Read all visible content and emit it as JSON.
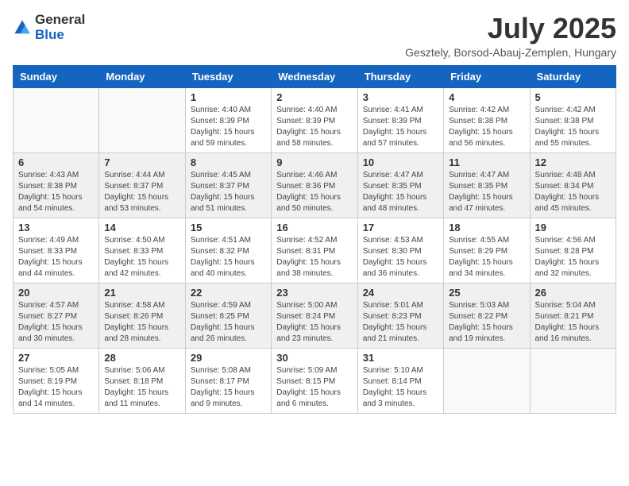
{
  "header": {
    "logo_general": "General",
    "logo_blue": "Blue",
    "month_year": "July 2025",
    "location": "Gesztely, Borsod-Abauj-Zemplen, Hungary"
  },
  "weekdays": [
    "Sunday",
    "Monday",
    "Tuesday",
    "Wednesday",
    "Thursday",
    "Friday",
    "Saturday"
  ],
  "weeks": [
    [
      {
        "day": "",
        "sunrise": "",
        "sunset": "",
        "daylight": ""
      },
      {
        "day": "",
        "sunrise": "",
        "sunset": "",
        "daylight": ""
      },
      {
        "day": "1",
        "sunrise": "Sunrise: 4:40 AM",
        "sunset": "Sunset: 8:39 PM",
        "daylight": "Daylight: 15 hours and 59 minutes."
      },
      {
        "day": "2",
        "sunrise": "Sunrise: 4:40 AM",
        "sunset": "Sunset: 8:39 PM",
        "daylight": "Daylight: 15 hours and 58 minutes."
      },
      {
        "day": "3",
        "sunrise": "Sunrise: 4:41 AM",
        "sunset": "Sunset: 8:39 PM",
        "daylight": "Daylight: 15 hours and 57 minutes."
      },
      {
        "day": "4",
        "sunrise": "Sunrise: 4:42 AM",
        "sunset": "Sunset: 8:38 PM",
        "daylight": "Daylight: 15 hours and 56 minutes."
      },
      {
        "day": "5",
        "sunrise": "Sunrise: 4:42 AM",
        "sunset": "Sunset: 8:38 PM",
        "daylight": "Daylight: 15 hours and 55 minutes."
      }
    ],
    [
      {
        "day": "6",
        "sunrise": "Sunrise: 4:43 AM",
        "sunset": "Sunset: 8:38 PM",
        "daylight": "Daylight: 15 hours and 54 minutes."
      },
      {
        "day": "7",
        "sunrise": "Sunrise: 4:44 AM",
        "sunset": "Sunset: 8:37 PM",
        "daylight": "Daylight: 15 hours and 53 minutes."
      },
      {
        "day": "8",
        "sunrise": "Sunrise: 4:45 AM",
        "sunset": "Sunset: 8:37 PM",
        "daylight": "Daylight: 15 hours and 51 minutes."
      },
      {
        "day": "9",
        "sunrise": "Sunrise: 4:46 AM",
        "sunset": "Sunset: 8:36 PM",
        "daylight": "Daylight: 15 hours and 50 minutes."
      },
      {
        "day": "10",
        "sunrise": "Sunrise: 4:47 AM",
        "sunset": "Sunset: 8:35 PM",
        "daylight": "Daylight: 15 hours and 48 minutes."
      },
      {
        "day": "11",
        "sunrise": "Sunrise: 4:47 AM",
        "sunset": "Sunset: 8:35 PM",
        "daylight": "Daylight: 15 hours and 47 minutes."
      },
      {
        "day": "12",
        "sunrise": "Sunrise: 4:48 AM",
        "sunset": "Sunset: 8:34 PM",
        "daylight": "Daylight: 15 hours and 45 minutes."
      }
    ],
    [
      {
        "day": "13",
        "sunrise": "Sunrise: 4:49 AM",
        "sunset": "Sunset: 8:33 PM",
        "daylight": "Daylight: 15 hours and 44 minutes."
      },
      {
        "day": "14",
        "sunrise": "Sunrise: 4:50 AM",
        "sunset": "Sunset: 8:33 PM",
        "daylight": "Daylight: 15 hours and 42 minutes."
      },
      {
        "day": "15",
        "sunrise": "Sunrise: 4:51 AM",
        "sunset": "Sunset: 8:32 PM",
        "daylight": "Daylight: 15 hours and 40 minutes."
      },
      {
        "day": "16",
        "sunrise": "Sunrise: 4:52 AM",
        "sunset": "Sunset: 8:31 PM",
        "daylight": "Daylight: 15 hours and 38 minutes."
      },
      {
        "day": "17",
        "sunrise": "Sunrise: 4:53 AM",
        "sunset": "Sunset: 8:30 PM",
        "daylight": "Daylight: 15 hours and 36 minutes."
      },
      {
        "day": "18",
        "sunrise": "Sunrise: 4:55 AM",
        "sunset": "Sunset: 8:29 PM",
        "daylight": "Daylight: 15 hours and 34 minutes."
      },
      {
        "day": "19",
        "sunrise": "Sunrise: 4:56 AM",
        "sunset": "Sunset: 8:28 PM",
        "daylight": "Daylight: 15 hours and 32 minutes."
      }
    ],
    [
      {
        "day": "20",
        "sunrise": "Sunrise: 4:57 AM",
        "sunset": "Sunset: 8:27 PM",
        "daylight": "Daylight: 15 hours and 30 minutes."
      },
      {
        "day": "21",
        "sunrise": "Sunrise: 4:58 AM",
        "sunset": "Sunset: 8:26 PM",
        "daylight": "Daylight: 15 hours and 28 minutes."
      },
      {
        "day": "22",
        "sunrise": "Sunrise: 4:59 AM",
        "sunset": "Sunset: 8:25 PM",
        "daylight": "Daylight: 15 hours and 26 minutes."
      },
      {
        "day": "23",
        "sunrise": "Sunrise: 5:00 AM",
        "sunset": "Sunset: 8:24 PM",
        "daylight": "Daylight: 15 hours and 23 minutes."
      },
      {
        "day": "24",
        "sunrise": "Sunrise: 5:01 AM",
        "sunset": "Sunset: 8:23 PM",
        "daylight": "Daylight: 15 hours and 21 minutes."
      },
      {
        "day": "25",
        "sunrise": "Sunrise: 5:03 AM",
        "sunset": "Sunset: 8:22 PM",
        "daylight": "Daylight: 15 hours and 19 minutes."
      },
      {
        "day": "26",
        "sunrise": "Sunrise: 5:04 AM",
        "sunset": "Sunset: 8:21 PM",
        "daylight": "Daylight: 15 hours and 16 minutes."
      }
    ],
    [
      {
        "day": "27",
        "sunrise": "Sunrise: 5:05 AM",
        "sunset": "Sunset: 8:19 PM",
        "daylight": "Daylight: 15 hours and 14 minutes."
      },
      {
        "day": "28",
        "sunrise": "Sunrise: 5:06 AM",
        "sunset": "Sunset: 8:18 PM",
        "daylight": "Daylight: 15 hours and 11 minutes."
      },
      {
        "day": "29",
        "sunrise": "Sunrise: 5:08 AM",
        "sunset": "Sunset: 8:17 PM",
        "daylight": "Daylight: 15 hours and 9 minutes."
      },
      {
        "day": "30",
        "sunrise": "Sunrise: 5:09 AM",
        "sunset": "Sunset: 8:15 PM",
        "daylight": "Daylight: 15 hours and 6 minutes."
      },
      {
        "day": "31",
        "sunrise": "Sunrise: 5:10 AM",
        "sunset": "Sunset: 8:14 PM",
        "daylight": "Daylight: 15 hours and 3 minutes."
      },
      {
        "day": "",
        "sunrise": "",
        "sunset": "",
        "daylight": ""
      },
      {
        "day": "",
        "sunrise": "",
        "sunset": "",
        "daylight": ""
      }
    ]
  ]
}
